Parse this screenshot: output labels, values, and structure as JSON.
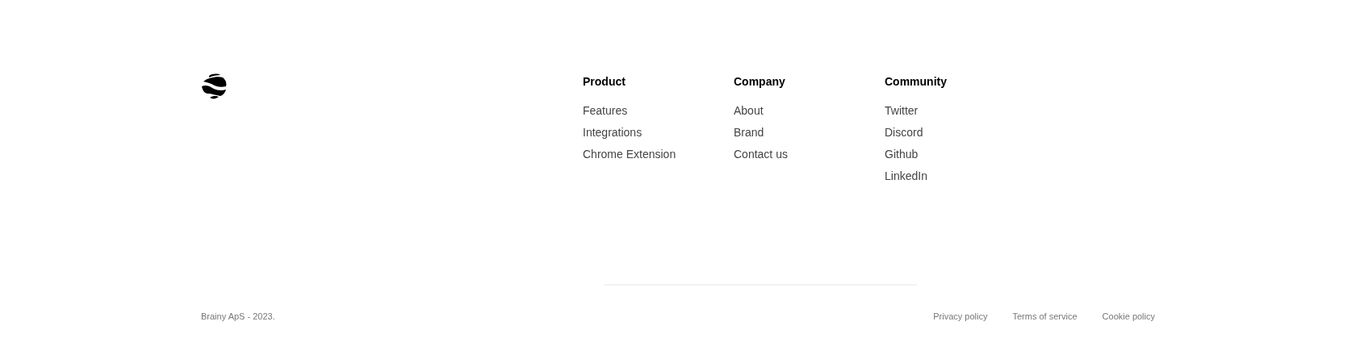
{
  "columns": [
    {
      "heading": "Product",
      "links": [
        "Features",
        "Integrations",
        "Chrome Extension"
      ]
    },
    {
      "heading": "Company",
      "links": [
        "About",
        "Brand",
        "Contact us"
      ]
    },
    {
      "heading": "Community",
      "links": [
        "Twitter",
        "Discord",
        "Github",
        "LinkedIn"
      ]
    }
  ],
  "copyright": "Brainy ApS - 2023.",
  "legal_links": [
    "Privacy policy",
    "Terms of service",
    "Cookie policy"
  ]
}
